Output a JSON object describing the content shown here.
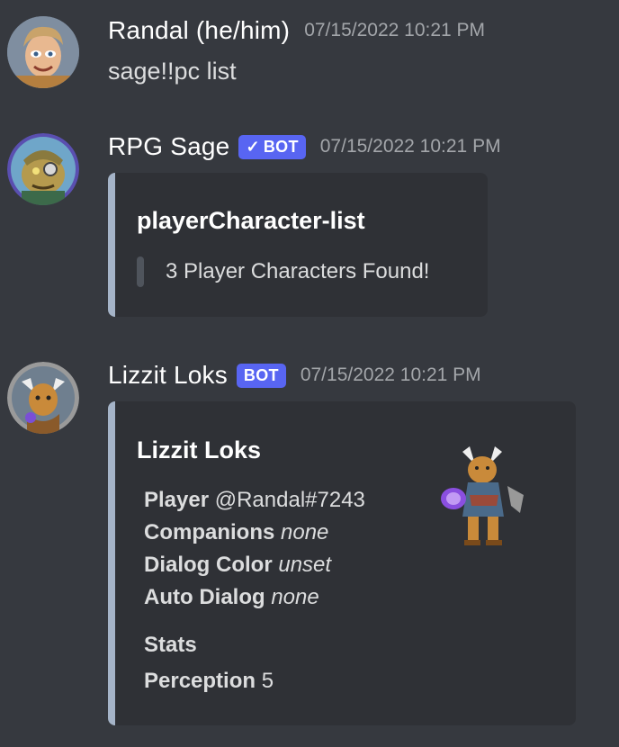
{
  "messages": [
    {
      "username": "Randal (he/him)",
      "timestamp": "07/15/2022 10:21 PM",
      "content": "sage!!pc list"
    },
    {
      "username": "RPG Sage",
      "bot_tag": "BOT",
      "bot_check": "✓",
      "timestamp": "07/15/2022 10:21 PM",
      "embed": {
        "title": "playerCharacter-list",
        "quote": "3 Player Characters Found!"
      }
    },
    {
      "username": "Lizzit Loks",
      "bot_tag": "BOT",
      "timestamp": "07/15/2022 10:21 PM",
      "embed": {
        "title": "Lizzit Loks",
        "fields": [
          {
            "label": "Player",
            "value": "@Randal#7243"
          },
          {
            "label": "Companions",
            "value": "none"
          },
          {
            "label": "Dialog Color",
            "value": "unset"
          },
          {
            "label": "Auto Dialog",
            "value": "none"
          }
        ],
        "stats_heading": "Stats",
        "stats": [
          {
            "label": "Perception",
            "value": "5"
          }
        ]
      }
    }
  ],
  "colors": {
    "background": "#36393f",
    "embed_bg": "#2f3136",
    "embed_border": "#a5b4c8",
    "bot_tag": "#5865f2",
    "timestamp": "#a3a6aa"
  },
  "icons": [
    "user-avatar-randal",
    "bot-avatar-rpg-sage",
    "character-avatar-lizzit",
    "character-thumbnail-lizzit",
    "verified-check-icon"
  ]
}
